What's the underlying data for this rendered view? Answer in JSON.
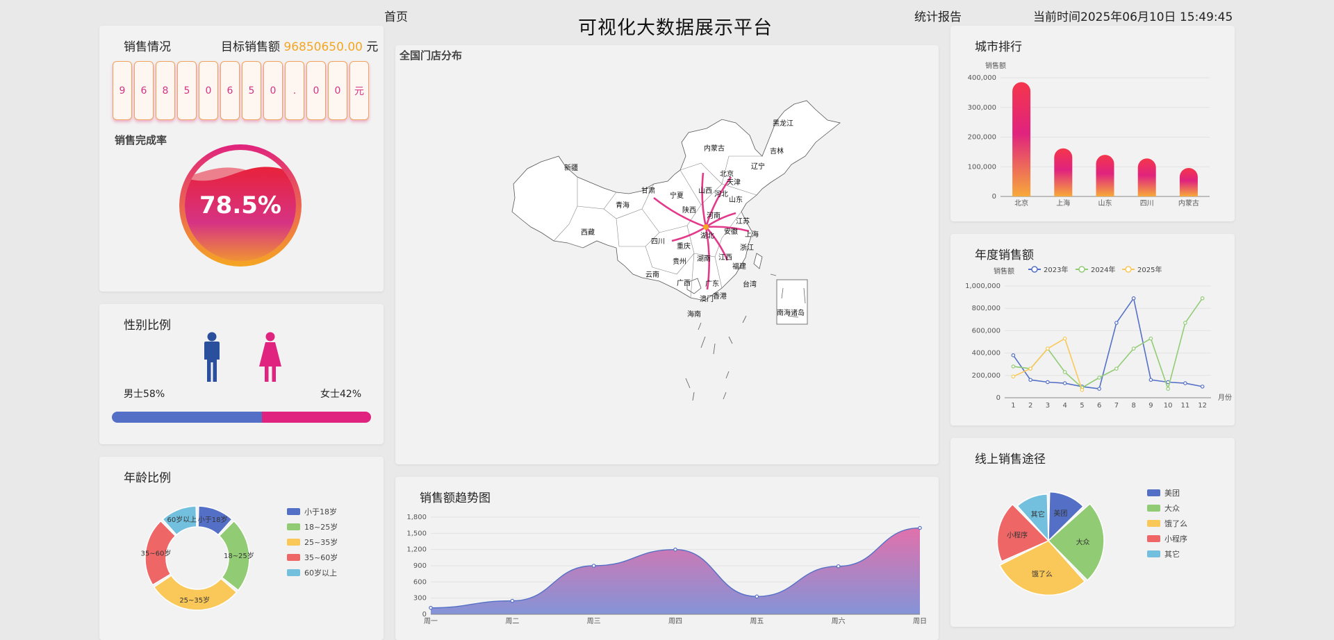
{
  "header": {
    "home_label": "首页",
    "title": "可视化大数据展示平台",
    "report_label": "统计报告",
    "time_text": "当前时间2025年06月10日 15:49:45"
  },
  "sales": {
    "title": "销售情况",
    "target_label": "目标销售额",
    "target_value": "96850650.00",
    "target_unit": "元",
    "digits": [
      "9",
      "6",
      "8",
      "5",
      "0",
      "6",
      "5",
      "0",
      ".",
      "0",
      "0",
      "元"
    ],
    "completion_title": "销售完成率",
    "completion_text": "78.5%",
    "completion_value": 0.785
  },
  "gender": {
    "title": "性别比例",
    "male_label": "男士58%",
    "female_label": "女士42%",
    "male_ratio": 0.58,
    "male_color": "#5470c6",
    "female_color": "#e0237e",
    "male_icon": "male-figure-icon",
    "female_icon": "female-figure-icon"
  },
  "map": {
    "title": "全国门店分布",
    "provinces": [
      "黑龙江",
      "吉林",
      "辽宁",
      "内蒙古",
      "北京",
      "天津",
      "河北",
      "山西",
      "山东",
      "宁夏",
      "甘肃",
      "新疆",
      "青海",
      "西藏",
      "陕西",
      "河南",
      "江苏",
      "安徽",
      "上海",
      "湖北",
      "四川",
      "重庆",
      "浙江",
      "湖南",
      "江西",
      "贵州",
      "福建",
      "云南",
      "广西",
      "广东",
      "台湾",
      "香港",
      "澳门",
      "海南",
      "南海诸岛"
    ]
  },
  "colors": {
    "blue": "#5470c6",
    "green": "#91cc75",
    "yellow": "#fac858",
    "red": "#ee6666",
    "cyan": "#73c0de",
    "pink": "#e0237e",
    "orange": "#f5a623"
  },
  "chart_data": [
    {
      "id": "city-rank",
      "type": "bar",
      "title": "城市排行",
      "ylabel": "销售额",
      "categories": [
        "北京",
        "上海",
        "山东",
        "四川",
        "内蒙古"
      ],
      "values": [
        385000,
        162000,
        140000,
        128000,
        96000
      ],
      "ylim": [
        0,
        400000
      ],
      "yticks": [
        "0",
        "100,000",
        "200,000",
        "300,000",
        "400,000"
      ]
    },
    {
      "id": "annual-sales",
      "type": "line",
      "title": "年度销售额",
      "ylabel": "销售额",
      "xlabel": "月份",
      "categories": [
        "1",
        "2",
        "3",
        "4",
        "5",
        "6",
        "7",
        "8",
        "9",
        "10",
        "11",
        "12"
      ],
      "ylim": [
        0,
        1000000
      ],
      "yticks": [
        "0",
        "200,000",
        "400,000",
        "600,000",
        "800,000",
        "1,000,000"
      ],
      "legend_position": "top",
      "series": [
        {
          "name": "2023年",
          "color": "#5470c6",
          "values": [
            380000,
            160000,
            140000,
            130000,
            100000,
            80000,
            670000,
            890000,
            160000,
            140000,
            130000,
            100000
          ]
        },
        {
          "name": "2024年",
          "color": "#91cc75",
          "values": [
            280000,
            260000,
            440000,
            230000,
            90000,
            180000,
            260000,
            440000,
            530000,
            80000,
            670000,
            890000
          ]
        },
        {
          "name": "2025年",
          "color": "#fac858",
          "values": [
            190000,
            260000,
            440000,
            530000,
            70000
          ]
        }
      ]
    },
    {
      "id": "age-ratio",
      "type": "pie",
      "title": "年龄比例",
      "legend_position": "right",
      "slices": [
        {
          "name": "小于18岁",
          "value": 12,
          "color": "#5470c6"
        },
        {
          "name": "18~25岁",
          "value": 24,
          "color": "#91cc75"
        },
        {
          "name": "25~35岁",
          "value": 30,
          "color": "#fac858"
        },
        {
          "name": "35~60岁",
          "value": 22,
          "color": "#ee6666"
        },
        {
          "name": "60岁以上",
          "value": 12,
          "color": "#73c0de"
        }
      ]
    },
    {
      "id": "online-channels",
      "type": "pie",
      "title": "线上销售途径",
      "legend_position": "right",
      "slices": [
        {
          "name": "美团",
          "value": 13,
          "color": "#5470c6",
          "radius": 0.88
        },
        {
          "name": "大众",
          "value": 25,
          "color": "#91cc75",
          "radius": 1.0
        },
        {
          "name": "饿了么",
          "value": 30,
          "color": "#fac858",
          "radius": 0.98
        },
        {
          "name": "小程序",
          "value": 20,
          "color": "#ee6666",
          "radius": 0.92
        },
        {
          "name": "其它",
          "value": 12,
          "color": "#73c0de",
          "radius": 0.84
        }
      ]
    },
    {
      "id": "sales-trend",
      "type": "area",
      "title": "销售额趋势图",
      "categories": [
        "周一",
        "周二",
        "周三",
        "周四",
        "周五",
        "周六",
        "周日"
      ],
      "values": [
        120,
        250,
        900,
        1200,
        330,
        890,
        1600
      ],
      "ylim": [
        0,
        1800
      ],
      "yticks": [
        "0",
        "300",
        "600",
        "900",
        "1,200",
        "1,500",
        "1,800"
      ]
    }
  ]
}
